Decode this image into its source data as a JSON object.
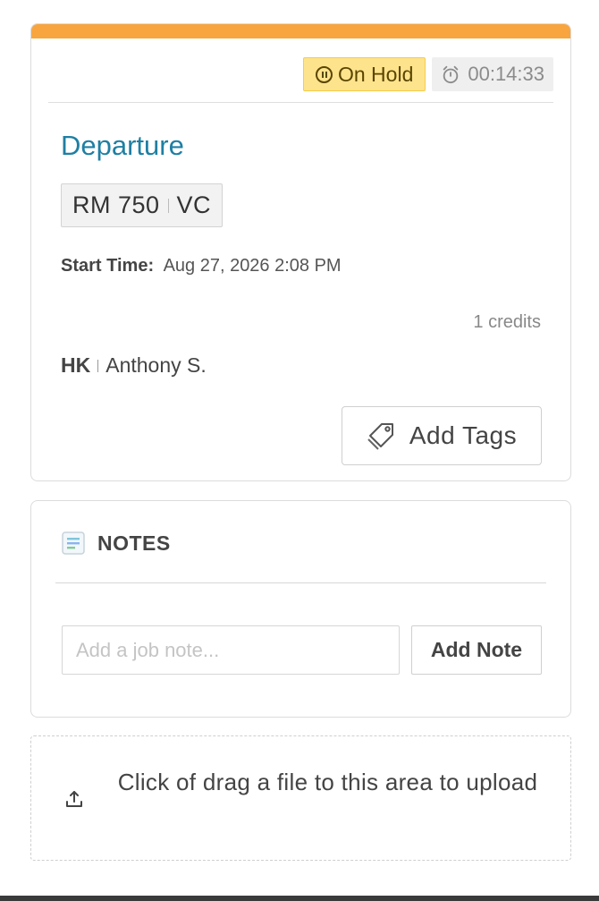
{
  "job": {
    "status_label": "On Hold",
    "timer": "00:14:33",
    "title": "Departure",
    "room_number": "RM 750",
    "room_status": "VC",
    "start_label": "Start Time:",
    "start_value": "Aug 27, 2026 2:08 PM",
    "credits": "1 credits",
    "assignee_code": "HK",
    "assignee_name": "Anthony S.",
    "add_tags_label": "Add Tags",
    "accent_color": "#f8a540",
    "title_color": "#1f7fa3"
  },
  "notes": {
    "title": "NOTES",
    "input_placeholder": "Add a job note...",
    "input_value": "",
    "add_button_label": "Add Note"
  },
  "upload": {
    "text": "Click of drag a file to this area to upload"
  },
  "icons": {
    "status": "pause-circle-icon",
    "timer": "stopwatch-icon",
    "tags": "tag-icon",
    "notes": "document-lines-icon",
    "upload": "upload-icon"
  }
}
